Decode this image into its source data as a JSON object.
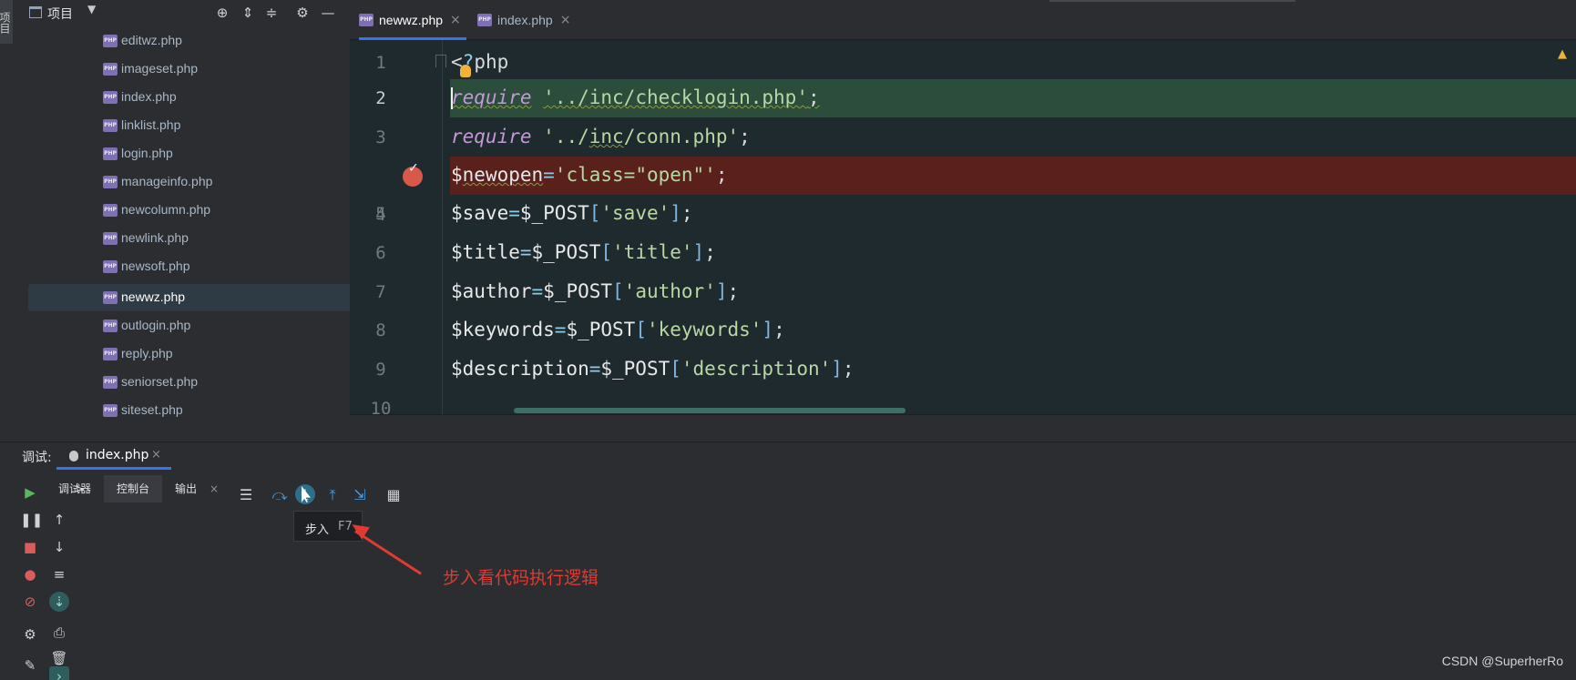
{
  "sidebar_strip": {
    "project_tab": "项目"
  },
  "project_panel": {
    "title": "项目",
    "files": [
      {
        "name": "editwz.php",
        "selected": false
      },
      {
        "name": "imageset.php",
        "selected": false
      },
      {
        "name": "index.php",
        "selected": false
      },
      {
        "name": "linklist.php",
        "selected": false
      },
      {
        "name": "login.php",
        "selected": false
      },
      {
        "name": "manageinfo.php",
        "selected": false
      },
      {
        "name": "newcolumn.php",
        "selected": false
      },
      {
        "name": "newlink.php",
        "selected": false
      },
      {
        "name": "newsoft.php",
        "selected": false
      },
      {
        "name": "newwz.php",
        "selected": true
      },
      {
        "name": "outlogin.php",
        "selected": false
      },
      {
        "name": "reply.php",
        "selected": false
      },
      {
        "name": "seniorset.php",
        "selected": false
      },
      {
        "name": "siteset.php",
        "selected": false
      }
    ],
    "icon_label": "PHP"
  },
  "editor": {
    "tabs": [
      {
        "label": "newwz.php",
        "active": true
      },
      {
        "label": "index.php",
        "active": false
      }
    ],
    "close_glyph": "×",
    "line_numbers": [
      "1",
      "2",
      "3",
      "4",
      "5",
      "6",
      "7",
      "8",
      "9",
      "10"
    ],
    "warning": "▲"
  },
  "debug_panel": {
    "header": "调试:",
    "tab_label": "index.php",
    "subtabs": [
      "调试器",
      "控制台",
      "输出"
    ],
    "prompt": ">",
    "tooltip": {
      "label": "步入",
      "shortcut": "F7"
    },
    "annotation": "步入看代码执行逻辑"
  },
  "watermark": "CSDN @SuperherRo",
  "colors": {
    "exec_line": "#2c4d3b",
    "breakpoint_line": "#5a201c",
    "accent": "#3574f0",
    "annotation": "#e03a32"
  }
}
